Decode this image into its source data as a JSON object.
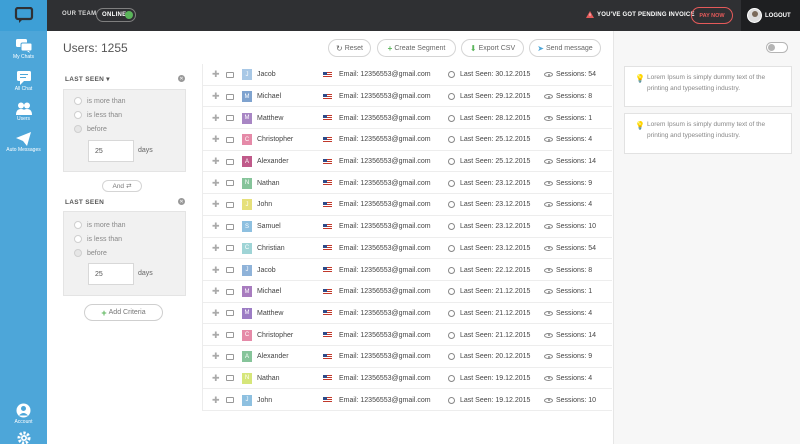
{
  "topbar": {
    "team_label": "OUR TEAM",
    "status": "ONLINE",
    "warning": "YOU'VE GOT PENDING INVOICE",
    "pay_label": "PAY NOW",
    "logout_label": "LOGOUT"
  },
  "sidebar": {
    "items": [
      {
        "label": "My Chats",
        "icon": "chats-icon"
      },
      {
        "label": "All Chat",
        "icon": "chat-bubble-icon"
      },
      {
        "label": "Users",
        "icon": "users-icon"
      },
      {
        "label": "Auto Messages",
        "icon": "paper-plane-icon"
      },
      {
        "label": "Account",
        "icon": "account-icon"
      },
      {
        "label": "",
        "icon": "gear-icon"
      }
    ]
  },
  "header": {
    "title": "Users: 1255",
    "buttons": {
      "reset": "Reset",
      "create_segment": "Create Segment",
      "export_csv": "Export CSV",
      "send_message": "Send message"
    }
  },
  "filters": [
    {
      "title": "LAST SEEN",
      "options": [
        "is more than",
        "is less than",
        "before"
      ],
      "value": "25",
      "unit": "days"
    },
    {
      "title": "LAST SEEN",
      "options": [
        "is more than",
        "is less than",
        "before"
      ],
      "value": "25",
      "unit": "days"
    }
  ],
  "and_label": "And",
  "add_criteria": "Add Criteria",
  "rows": [
    {
      "initial": "J",
      "name": "Jacob",
      "color": "#a8c8e6",
      "email": "Email: 12356553@gmail.com",
      "seen": "Last Seen: 30.12.2015",
      "sessions": "Sessions: 54"
    },
    {
      "initial": "M",
      "name": "Michael",
      "color": "#7fa3cf",
      "email": "Email: 12356553@gmail.com",
      "seen": "Last Seen: 29.12.2015",
      "sessions": "Sessions: 8"
    },
    {
      "initial": "M",
      "name": "Matthew",
      "color": "#a886c4",
      "email": "Email: 12356553@gmail.com",
      "seen": "Last Seen: 28.12.2015",
      "sessions": "Sessions: 1"
    },
    {
      "initial": "C",
      "name": "Christopher",
      "color": "#e58aa8",
      "email": "Email: 12356553@gmail.com",
      "seen": "Last Seen: 25.12.2015",
      "sessions": "Sessions: 4"
    },
    {
      "initial": "A",
      "name": "Alexander",
      "color": "#c05a8a",
      "email": "Email: 12356553@gmail.com",
      "seen": "Last Seen: 25.12.2015",
      "sessions": "Sessions: 14"
    },
    {
      "initial": "N",
      "name": "Nathan",
      "color": "#86c49a",
      "email": "Email: 12356553@gmail.com",
      "seen": "Last Seen: 23.12.2015",
      "sessions": "Sessions: 9"
    },
    {
      "initial": "J",
      "name": "John",
      "color": "#e6e07a",
      "email": "Email: 12356553@gmail.com",
      "seen": "Last Seen: 23.12.2015",
      "sessions": "Sessions: 4"
    },
    {
      "initial": "S",
      "name": "Samuel",
      "color": "#8ec0e0",
      "email": "Email: 12356553@gmail.com",
      "seen": "Last Seen: 23.12.2015",
      "sessions": "Sessions: 10"
    },
    {
      "initial": "C",
      "name": "Christian",
      "color": "#9fd4d6",
      "email": "Email: 12356553@gmail.com",
      "seen": "Last Seen: 23.12.2015",
      "sessions": "Sessions: 54"
    },
    {
      "initial": "J",
      "name": "Jacob",
      "color": "#8fb3d9",
      "email": "Email: 12356553@gmail.com",
      "seen": "Last Seen: 22.12.2015",
      "sessions": "Sessions: 8"
    },
    {
      "initial": "M",
      "name": "Michael",
      "color": "#a87cbf",
      "email": "Email: 12356553@gmail.com",
      "seen": "Last Seen: 21.12.2015",
      "sessions": "Sessions: 1"
    },
    {
      "initial": "M",
      "name": "Matthew",
      "color": "#9c7cc4",
      "email": "Email: 12356553@gmail.com",
      "seen": "Last Seen: 21.12.2015",
      "sessions": "Sessions: 4"
    },
    {
      "initial": "C",
      "name": "Christopher",
      "color": "#e58aa8",
      "email": "Email: 12356553@gmail.com",
      "seen": "Last Seen: 21.12.2015",
      "sessions": "Sessions: 14"
    },
    {
      "initial": "A",
      "name": "Alexander",
      "color": "#86c49a",
      "email": "Email: 12356553@gmail.com",
      "seen": "Last Seen: 20.12.2015",
      "sessions": "Sessions: 9"
    },
    {
      "initial": "N",
      "name": "Nathan",
      "color": "#d6e67a",
      "email": "Email: 12356553@gmail.com",
      "seen": "Last Seen: 19.12.2015",
      "sessions": "Sessions: 4"
    },
    {
      "initial": "J",
      "name": "John",
      "color": "#8ec0e0",
      "email": "Email: 12356553@gmail.com",
      "seen": "Last Seen: 19.12.2015",
      "sessions": "Sessions: 10"
    }
  ],
  "notes": [
    "Lorem Ipsum is simply dummy text of the printing and typesetting industry.",
    "Lorem Ipsum is simply dummy text of the printing and typesetting industry."
  ]
}
